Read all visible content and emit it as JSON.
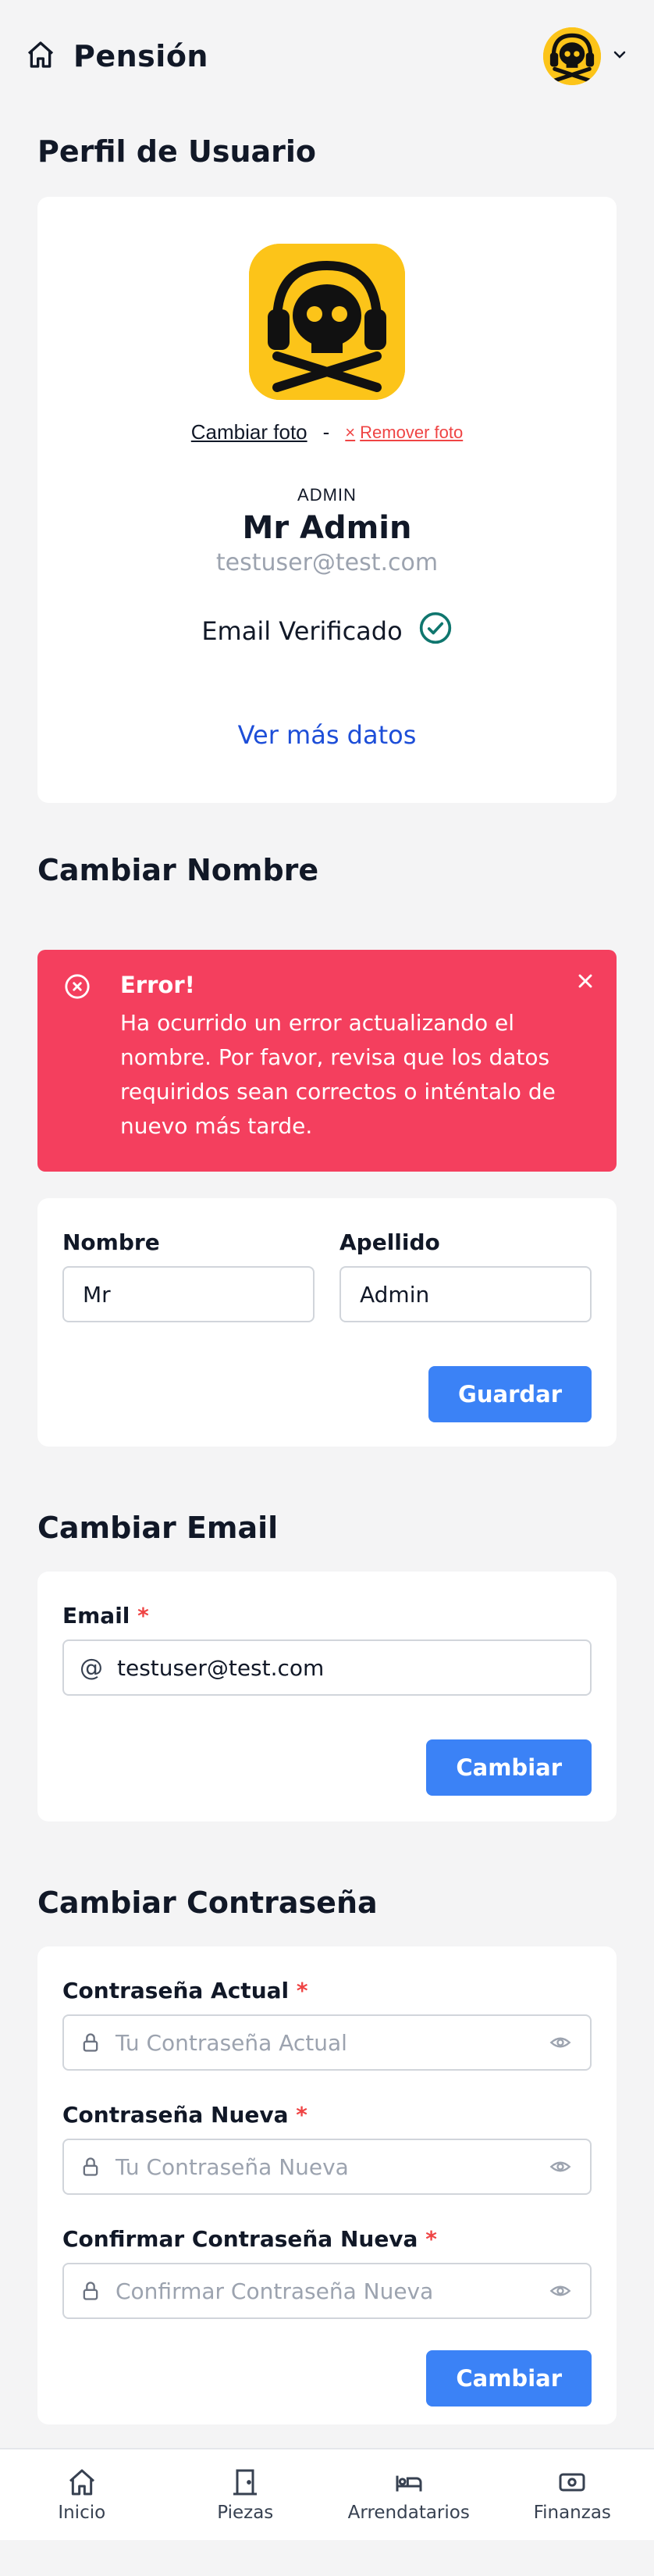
{
  "header": {
    "title": "Pensión",
    "home_icon": "home-icon",
    "avatar_icon": "skull-headphones-icon"
  },
  "profile": {
    "section_title": "Perfil de Usuario",
    "change_photo": "Cambiar foto",
    "separator": "-",
    "remove_photo": "Remover foto",
    "remove_icon": "×",
    "role": "ADMIN",
    "name": "Mr Admin",
    "email": "testuser@test.com",
    "verified_label": "Email Verificado",
    "more_link": "Ver más datos"
  },
  "change_name": {
    "section_title": "Cambiar Nombre",
    "alert": {
      "title": "Error!",
      "message": "Ha ocurrido un error actualizando el nombre. Por favor, revisa que los datos requiridos sean correctos o inténtalo de nuevo más tarde."
    },
    "first_name_label": "Nombre",
    "first_name_value": "Mr",
    "last_name_label": "Apellido",
    "last_name_value": "Admin",
    "save_label": "Guardar"
  },
  "change_email": {
    "section_title": "Cambiar Email",
    "email_label": "Email",
    "required_mark": "*",
    "email_value": "testuser@test.com",
    "at_icon": "@",
    "submit_label": "Cambiar"
  },
  "change_password": {
    "section_title": "Cambiar Contraseña",
    "current_label": "Contraseña Actual",
    "current_placeholder": "Tu Contraseña Actual",
    "new_label": "Contraseña Nueva",
    "new_placeholder": "Tu Contraseña Nueva",
    "confirm_label": "Confirmar Contraseña Nueva",
    "confirm_placeholder": "Confirmar Contraseña Nueva",
    "required_mark": "*",
    "submit_label": "Cambiar"
  },
  "nav": {
    "items": [
      {
        "label": "Inicio",
        "icon": "home-icon"
      },
      {
        "label": "Piezas",
        "icon": "door-icon"
      },
      {
        "label": "Arrendatarios",
        "icon": "bed-icon"
      },
      {
        "label": "Finanzas",
        "icon": "cash-icon"
      }
    ]
  },
  "colors": {
    "accent": "#3b82f6",
    "error": "#f43f5e",
    "avatar_bg": "#fcc419",
    "link": "#1d4ed8",
    "verified": "#0f766e"
  }
}
